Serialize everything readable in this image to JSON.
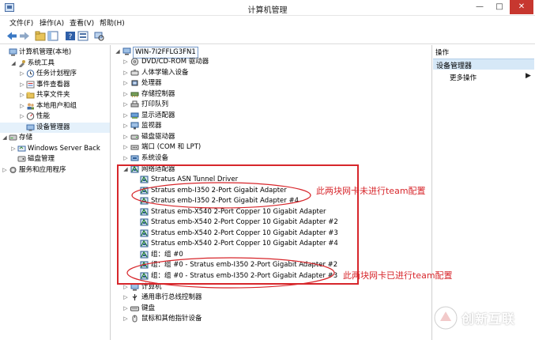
{
  "window": {
    "title": "计算机管理",
    "min": "—",
    "max": "□",
    "close": "✕"
  },
  "menu": [
    "文件(F)",
    "操作(A)",
    "查看(V)",
    "帮助(H)"
  ],
  "left_tree": [
    {
      "label": "计算机管理(本地)",
      "level": 0,
      "expander": "",
      "icon": "computer-icon"
    },
    {
      "label": "系统工具",
      "level": 1,
      "expander": "◢",
      "icon": "tools-icon"
    },
    {
      "label": "任务计划程序",
      "level": 2,
      "expander": "▷",
      "icon": "clock-icon"
    },
    {
      "label": "事件查看器",
      "level": 2,
      "expander": "▷",
      "icon": "event-icon"
    },
    {
      "label": "共享文件夹",
      "level": 2,
      "expander": "▷",
      "icon": "folder-icon"
    },
    {
      "label": "本地用户和组",
      "level": 2,
      "expander": "▷",
      "icon": "users-icon"
    },
    {
      "label": "性能",
      "level": 2,
      "expander": "▷",
      "icon": "performance-icon"
    },
    {
      "label": "设备管理器",
      "level": 2,
      "expander": "",
      "icon": "device-manager-icon"
    },
    {
      "label": "存储",
      "level": 0,
      "expander": "◢",
      "icon": "storage-icon"
    },
    {
      "label": "Windows Server Back",
      "level": 1,
      "expander": "▷",
      "icon": "backup-icon"
    },
    {
      "label": "磁盘管理",
      "level": 1,
      "expander": "",
      "icon": "disk-icon"
    },
    {
      "label": "服务和应用程序",
      "level": 0,
      "expander": "▷",
      "icon": "services-icon"
    }
  ],
  "device_tree": {
    "host": "WIN-7I2FFLG3FN1",
    "items": [
      {
        "label": "DVD/CD-ROM 驱动器",
        "level": 1,
        "expander": "▷",
        "icon": "dvd-icon"
      },
      {
        "label": "人体学输入设备",
        "level": 1,
        "expander": "▷",
        "icon": "hid-icon"
      },
      {
        "label": "处理器",
        "level": 1,
        "expander": "▷",
        "icon": "processor-icon"
      },
      {
        "label": "存储控制器",
        "level": 1,
        "expander": "▷",
        "icon": "storage-controller-icon"
      },
      {
        "label": "打印队列",
        "level": 1,
        "expander": "▷",
        "icon": "printer-icon"
      },
      {
        "label": "显示适配器",
        "level": 1,
        "expander": "▷",
        "icon": "display-icon"
      },
      {
        "label": "监视器",
        "level": 1,
        "expander": "▷",
        "icon": "monitor-icon"
      },
      {
        "label": "磁盘驱动器",
        "level": 1,
        "expander": "▷",
        "icon": "disk-drive-icon"
      },
      {
        "label": "端口 (COM 和 LPT)",
        "level": 1,
        "expander": "▷",
        "icon": "port-icon"
      },
      {
        "label": "系统设备",
        "level": 1,
        "expander": "▷",
        "icon": "system-device-icon"
      },
      {
        "label": "网络适配器",
        "level": 1,
        "expander": "◢",
        "icon": "network-adapter-icon"
      },
      {
        "label": "Stratus ASN Tunnel Driver",
        "level": 2,
        "expander": "",
        "icon": "network-adapter-icon"
      },
      {
        "label": "Stratus emb-I350 2-Port Gigabit Adapter",
        "level": 2,
        "expander": "",
        "icon": "network-adapter-icon"
      },
      {
        "label": "Stratus emb-I350 2-Port Gigabit Adapter #4",
        "level": 2,
        "expander": "",
        "icon": "network-adapter-icon"
      },
      {
        "label": "Stratus emb-X540 2-Port Copper 10 Gigabit Adapter",
        "level": 2,
        "expander": "",
        "icon": "network-adapter-icon"
      },
      {
        "label": "Stratus emb-X540 2-Port Copper 10 Gigabit Adapter #2",
        "level": 2,
        "expander": "",
        "icon": "network-adapter-icon"
      },
      {
        "label": "Stratus emb-X540 2-Port Copper 10 Gigabit Adapter #3",
        "level": 2,
        "expander": "",
        "icon": "network-adapter-icon"
      },
      {
        "label": "Stratus emb-X540 2-Port Copper 10 Gigabit Adapter #4",
        "level": 2,
        "expander": "",
        "icon": "network-adapter-icon"
      },
      {
        "label": "组：组 #0",
        "level": 2,
        "expander": "",
        "icon": "network-adapter-icon"
      },
      {
        "label": "组：组 #0 - Stratus emb-I350 2-Port Gigabit Adapter #2",
        "level": 2,
        "expander": "",
        "icon": "network-adapter-icon"
      },
      {
        "label": "组：组 #0 - Stratus emb-I350 2-Port Gigabit Adapter #3",
        "level": 2,
        "expander": "",
        "icon": "network-adapter-icon"
      },
      {
        "label": "计算机",
        "level": 1,
        "expander": "▷",
        "icon": "computer-icon"
      },
      {
        "label": "通用串行总线控制器",
        "level": 1,
        "expander": "▷",
        "icon": "usb-icon"
      },
      {
        "label": "键盘",
        "level": 1,
        "expander": "▷",
        "icon": "keyboard-icon"
      },
      {
        "label": "鼠标和其他指针设备",
        "level": 1,
        "expander": "▷",
        "icon": "mouse-icon"
      }
    ]
  },
  "actions": {
    "header": "操作",
    "section": "设备管理器",
    "more": "更多操作",
    "arrow": "▶"
  },
  "annotations": {
    "not_teamed": "此两块网卡未进行team配置",
    "teamed": "此两块网卡已进行team配置"
  },
  "watermark": {
    "text": "创新互联"
  },
  "colors": {
    "annotation": "#d7262b",
    "selection": "#e5f1fb",
    "action_section": "#d6e8f7"
  }
}
